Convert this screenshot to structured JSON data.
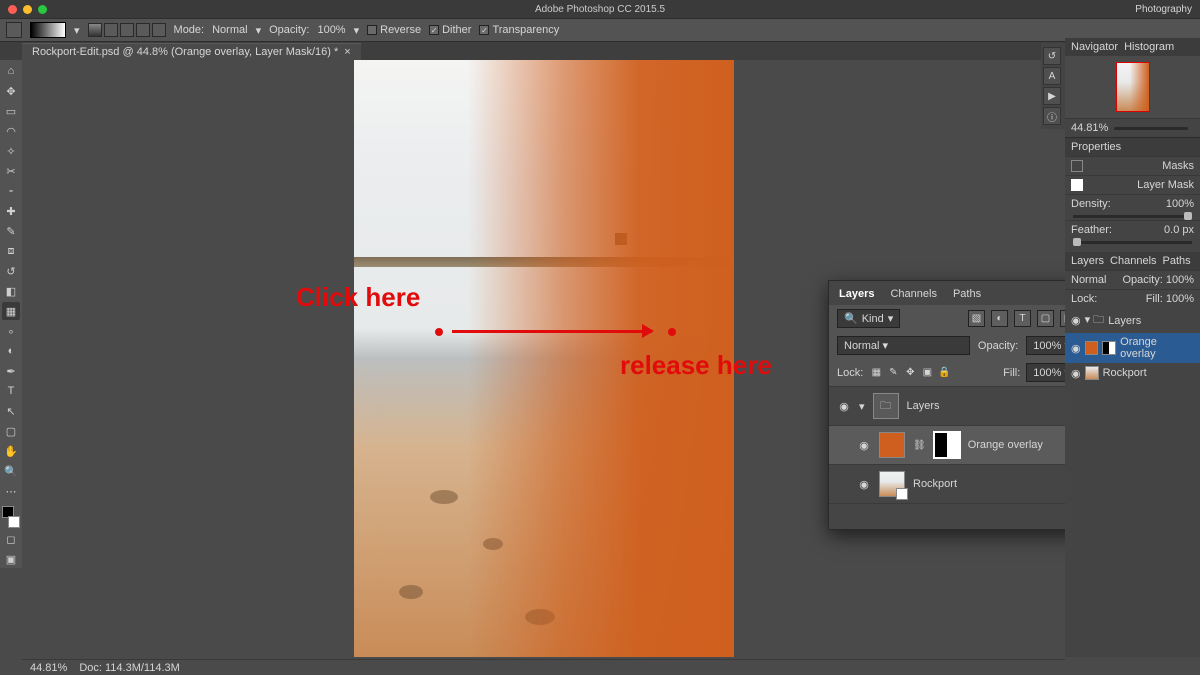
{
  "app": {
    "title": "Adobe Photoshop CC 2015.5",
    "workspace": "Photography"
  },
  "options_bar": {
    "mode_label": "Mode:",
    "mode_value": "Normal",
    "opacity_label": "Opacity:",
    "opacity_value": "100%",
    "reverse": "Reverse",
    "dither": "Dither",
    "transparency": "Transparency"
  },
  "doc_tab": {
    "label": "Rockport-Edit.psd @ 44.8% (Orange overlay, Layer Mask/16) *",
    "close": "×"
  },
  "annotations": {
    "click": "Click here",
    "release": "release here"
  },
  "layers_panel": {
    "tabs": [
      "Layers",
      "Channels",
      "Paths"
    ],
    "filter_kind_label": "Kind",
    "blend_mode": "Normal",
    "opacity_label": "Opacity:",
    "opacity_value": "100%",
    "lock_label": "Lock:",
    "fill_label": "Fill:",
    "fill_value": "100%",
    "group_name": "Layers",
    "items": [
      {
        "name": "Orange overlay"
      },
      {
        "name": "Rockport"
      }
    ]
  },
  "navigator": {
    "tabs": [
      "Navigator",
      "Histogram"
    ],
    "zoom": "44.81%"
  },
  "properties": {
    "title": "Properties",
    "masks": "Masks",
    "layer_mask": "Layer Mask",
    "density_label": "Density:",
    "density_value": "100%",
    "feather_label": "Feather:",
    "feather_value": "0.0 px"
  },
  "mini_layers": {
    "tabs": [
      "Layers",
      "Channels",
      "Paths"
    ],
    "blend": "Normal",
    "opacity_label": "Opacity:",
    "opacity_value": "100%",
    "lock_label": "Lock:",
    "fill_label": "Fill:",
    "fill_value": "100%",
    "group": "Layers",
    "items": [
      {
        "name": "Orange overlay"
      },
      {
        "name": "Rockport"
      }
    ]
  },
  "status": {
    "zoom": "44.81%",
    "doc_info": "Doc: 114.3M/114.3M"
  },
  "colors": {
    "overlay": "#cf5f1e",
    "annotation": "#e10b0b",
    "traffic": [
      "#ff5f57",
      "#febc2e",
      "#28c840"
    ]
  }
}
